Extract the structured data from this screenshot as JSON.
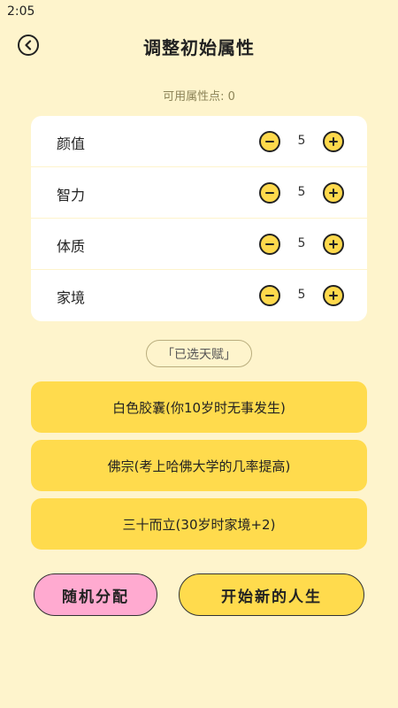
{
  "status_bar": {
    "time": "2:05"
  },
  "header": {
    "title": "调整初始属性"
  },
  "available_points": "可用属性点: 0",
  "attributes": [
    {
      "name": "颜值",
      "value": "5"
    },
    {
      "name": "智力",
      "value": "5"
    },
    {
      "name": "体质",
      "value": "5"
    },
    {
      "name": "家境",
      "value": "5"
    }
  ],
  "talents": {
    "header": "「已选天赋」",
    "items": [
      "白色胶囊(你10岁时无事发生)",
      "佛宗(考上哈佛大学的几率提高)",
      "三十而立(30岁时家境+2)"
    ]
  },
  "buttons": {
    "random": "随机分配",
    "start": "开始新的人生"
  },
  "colors": {
    "background": "#fef4cc",
    "card": "#ffffff",
    "accent_yellow": "#ffdb4d",
    "accent_pink": "#ffaad0"
  }
}
